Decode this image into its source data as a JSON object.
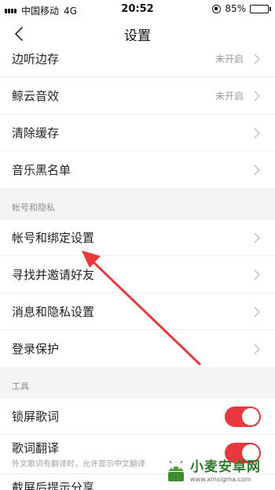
{
  "status_bar": {
    "carrier": "中国移动",
    "network": "4G",
    "time": "20:52",
    "battery": "85%",
    "battery_level": 0.85
  },
  "nav": {
    "title": "设置",
    "back_icon": "chevron-left-icon"
  },
  "rows_top": [
    {
      "label": "边听边存",
      "value": "未开启"
    },
    {
      "label": "鲸云音效",
      "value": "未开启"
    },
    {
      "label": "清除缓存",
      "value": ""
    },
    {
      "label": "音乐黑名单",
      "value": ""
    }
  ],
  "section_account": {
    "title": "帐号和隐私"
  },
  "rows_account": [
    {
      "label": "帐号和绑定设置"
    },
    {
      "label": "寻找并邀请好友"
    },
    {
      "label": "消息和隐私设置"
    },
    {
      "label": "登录保护"
    }
  ],
  "section_tools": {
    "title": "工具"
  },
  "tools": [
    {
      "label": "锁屏歌词",
      "enabled": true
    },
    {
      "label": "歌词翻译",
      "enabled": true,
      "sub": "外文歌词有翻译时，允许显示中文翻译"
    },
    {
      "label": "截屏后提示分享"
    }
  ],
  "colors": {
    "accent": "#e8383d",
    "annotation_arrow": "#e83a3a"
  },
  "watermark": {
    "main": "小麦安卓网",
    "url": "www.xmsigma.com"
  }
}
